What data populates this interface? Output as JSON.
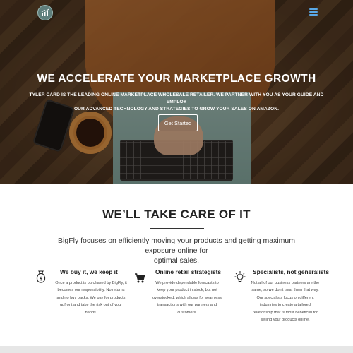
{
  "header": {
    "logo_icon": "chart-logo-icon",
    "menu_icon": "hamburger-menu-icon",
    "accent_color": "#5aa8e6"
  },
  "hero": {
    "title": "WE ACCELERATE YOUR MARKETPLACE GROWTH",
    "subtitle_line1": "TYLER CARD IS THE LEADING ONLINE MARKETPLACE WHOLESALE RETAILER. WE PARTNER WITH YOU AS YOUR GUIDE AND EMPLOY",
    "subtitle_line2": "OUR ADVANCED TECHNOLOGY AND STRATEGIES TO GROW YOUR SALES ON AMAZON.",
    "cta_label": "Get Started"
  },
  "section": {
    "title": "WE’LL TAKE CARE OF IT",
    "intro_line1": "BigFly focuses on efficiently moving your products and getting maximum exposure online for",
    "intro_line2": "optimal sales."
  },
  "features": [
    {
      "icon": "money-bag-icon",
      "title": "We buy it, we keep it",
      "lines": [
        "Once a product is purchased by BigFly, it",
        "becomes our responsibility. No returns",
        "and no buy backs. We pay for products",
        "upfront and take the risk out of your",
        "hands."
      ]
    },
    {
      "icon": "shopping-cart-icon",
      "title": "Online retail strategists",
      "lines": [
        "We provide dependable forecasts to",
        "keep your product in stock, but not",
        "overstocked, which allows for seamless",
        "transactions with our partners and",
        "customers."
      ]
    },
    {
      "icon": "lightbulb-icon",
      "title": "Specialists, not generalists",
      "lines": [
        "Not all of our business partners are the",
        "same, so we don’t treat them that way.",
        "Our specialists focus on different",
        "industries to create a tailored",
        "relationship that is most beneficial for",
        "selling your products online."
      ]
    }
  ]
}
